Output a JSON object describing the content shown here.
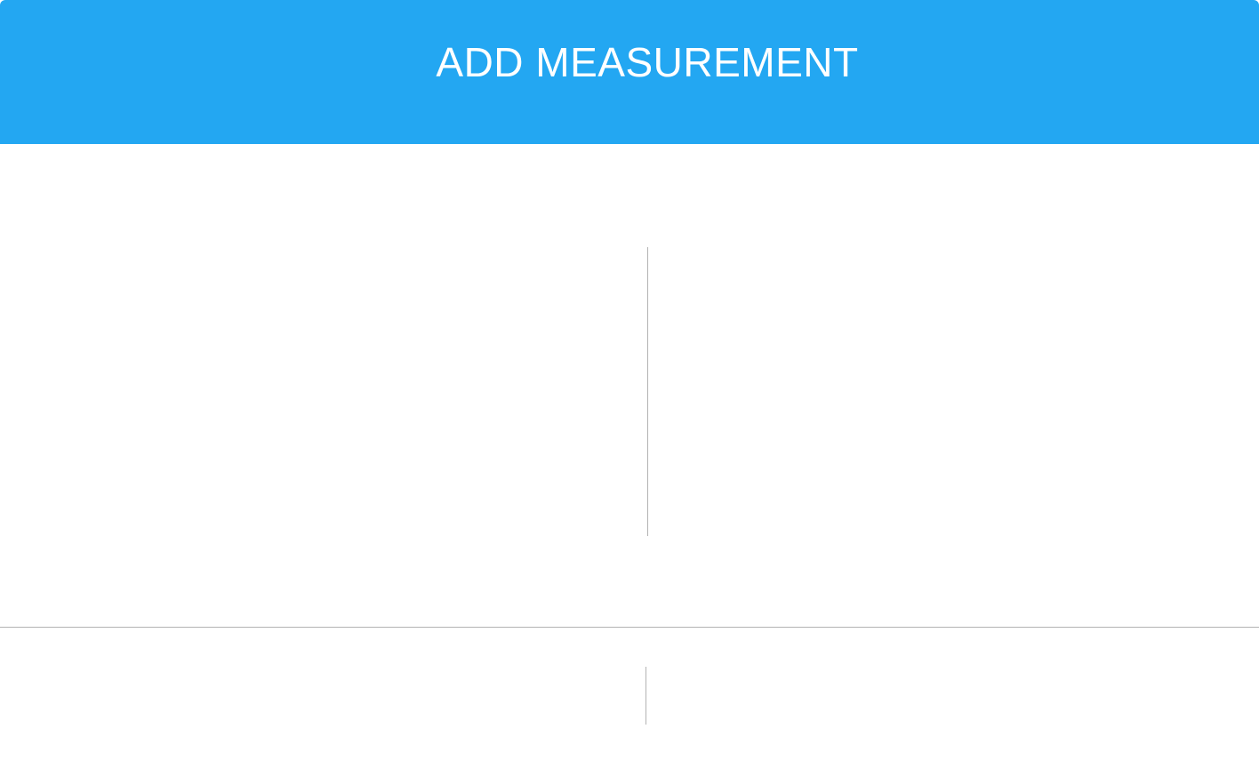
{
  "header": {
    "title": "ADD MEASUREMENT"
  },
  "colors": {
    "header_background": "#23a7f2",
    "header_text": "#ffffff",
    "divider": "#b3b3b3",
    "background": "#ffffff"
  }
}
